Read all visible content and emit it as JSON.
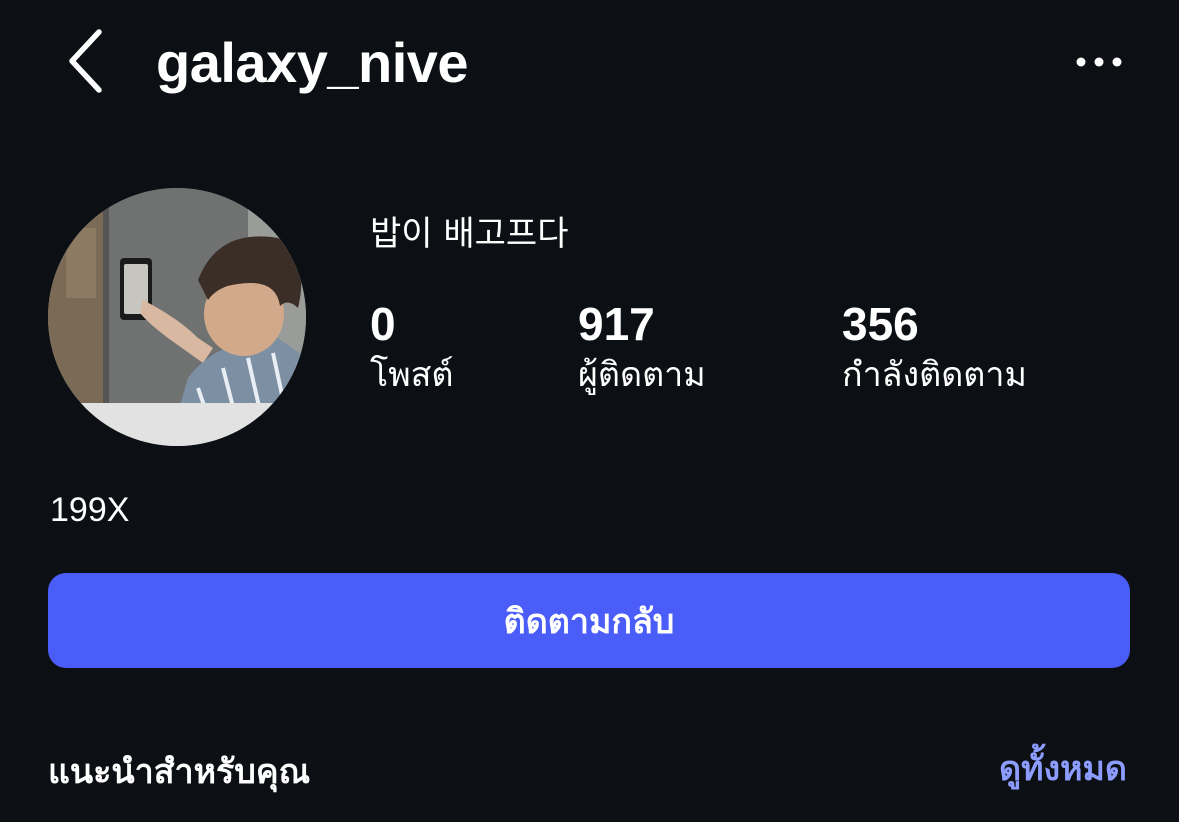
{
  "header": {
    "username": "galaxy_nive",
    "back_icon": "chevron-left-icon",
    "more_icon": "more-horizontal-icon"
  },
  "profile": {
    "display_name": "밥이 배고프다",
    "bio": "199X",
    "avatar_description": "profile-photo"
  },
  "stats": [
    {
      "count": "0",
      "label": "โพสต์"
    },
    {
      "count": "917",
      "label": "ผู้ติดตาม"
    },
    {
      "count": "356",
      "label": "กำลังติดตาม"
    }
  ],
  "actions": {
    "follow_back_label": "ติดตามกลับ"
  },
  "suggestions": {
    "title": "แนะนำสำหรับคุณ",
    "see_all_label": "ดูทั้งหมด"
  },
  "colors": {
    "background": "#0c1014",
    "primary_button": "#4a5df9",
    "link": "#8c9cff",
    "text": "#ffffff"
  }
}
